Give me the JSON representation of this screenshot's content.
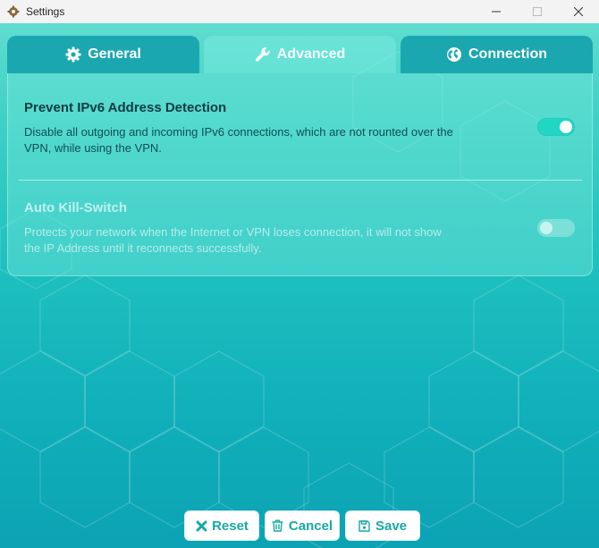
{
  "window": {
    "title": "Settings",
    "app_icon": "settings-app-icon",
    "controls": [
      "minimize-icon",
      "maximize-icon",
      "close-icon"
    ]
  },
  "tabs": [
    {
      "label": "General",
      "icon": "gear-icon",
      "state": "inactive"
    },
    {
      "label": "Advanced",
      "icon": "wrench-icon",
      "state": "active"
    },
    {
      "label": "Connection",
      "icon": "globe-icon",
      "state": "inactive"
    }
  ],
  "settings": [
    {
      "title": "Prevent IPv6 Address Detection",
      "description": "Disable all outgoing and incoming IPv6 connections, which are not rounted over the VPN, while using the VPN.",
      "enabled": true,
      "toggle_on": true
    },
    {
      "title": "Auto Kill-Switch",
      "description": "Protects your network when the Internet or VPN loses connection, it will not show the IP Address until it reconnects successfully.",
      "enabled": false,
      "toggle_on": false
    }
  ],
  "actions": {
    "reset_label": "Reset",
    "cancel_label": "Cancel",
    "save_label": "Save"
  },
  "colors": {
    "accent": "#16a9a4",
    "background_top": "#5fdccf",
    "background_bottom": "#0ca3b4",
    "tab_inactive": "#1aa7b0",
    "toggle_on": "#22d6c4"
  }
}
